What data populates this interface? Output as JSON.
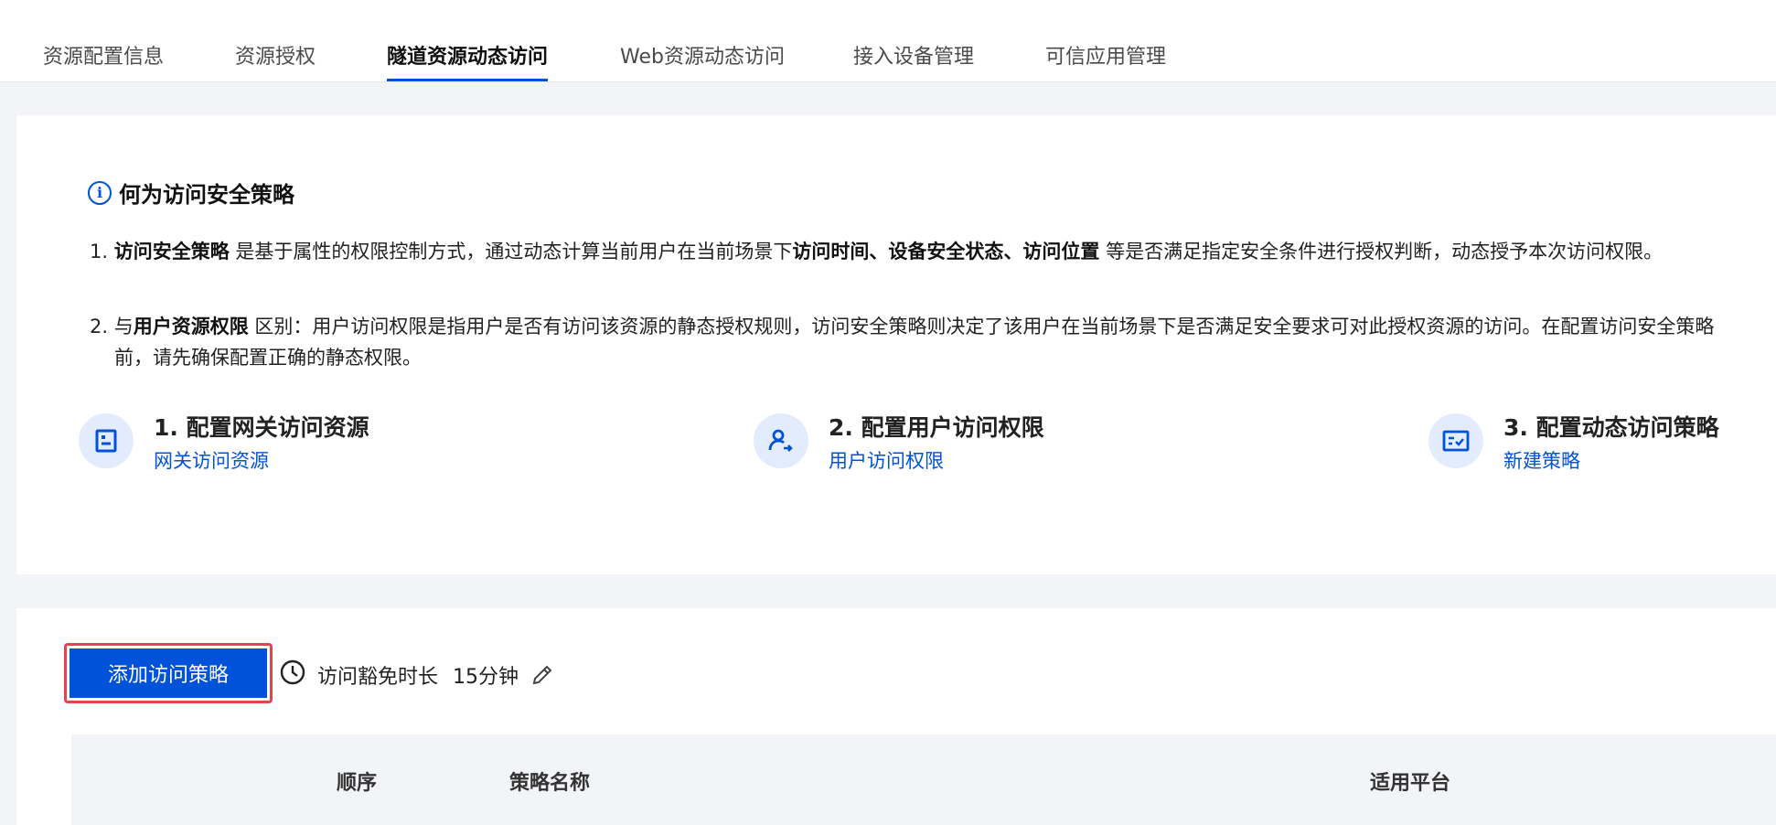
{
  "tabs": [
    {
      "label": "资源配置信息",
      "active": false
    },
    {
      "label": "资源授权",
      "active": false
    },
    {
      "label": "隧道资源动态访问",
      "active": true
    },
    {
      "label": "Web资源动态访问",
      "active": false
    },
    {
      "label": "接入设备管理",
      "active": false
    },
    {
      "label": "可信应用管理",
      "active": false
    }
  ],
  "info": {
    "title": "何为访问安全策略",
    "points": [
      {
        "num": "1.",
        "parts": [
          {
            "text": "访问安全策略",
            "bold": true
          },
          {
            "text": " 是基于属性的权限控制方式，通过动态计算当前用户在当前场景下",
            "bold": false
          },
          {
            "text": "访问时间、设备安全状态、访问位置",
            "bold": true
          },
          {
            "text": " 等是否满足指定安全条件进行授权判断，动态授予本次访问权限。",
            "bold": false
          }
        ]
      },
      {
        "num": "2.",
        "parts": [
          {
            "text": "与",
            "bold": false
          },
          {
            "text": "用户资源权限",
            "bold": true
          },
          {
            "text": " 区别：用户访问权限是指用户是否有访问该资源的静态授权规则，访问安全策略则决定了该用户在当前场景下是否满足安全要求可对此授权资源的访问。在配置访问安全策略前，请先确保配置正确的静态权限。",
            "bold": false
          }
        ]
      }
    ]
  },
  "steps": [
    {
      "title": "1. 配置网关访问资源",
      "link": "网关访问资源",
      "icon": "gateway-resource-icon"
    },
    {
      "title": "2. 配置用户访问权限",
      "link": "用户访问权限",
      "icon": "user-permission-icon"
    },
    {
      "title": "3. 配置动态访问策略",
      "link": "新建策略",
      "icon": "policy-icon"
    }
  ],
  "toolbar": {
    "add_label": "添加访问策略",
    "timeout_label": "访问豁免时长",
    "timeout_value": "15分钟"
  },
  "table": {
    "headers": [
      "顺序",
      "策略名称",
      "适用平台"
    ]
  },
  "colors": {
    "accent": "#0052d9",
    "highlight_border": "#e5444f",
    "icon_bg": "#e3ecfd"
  }
}
